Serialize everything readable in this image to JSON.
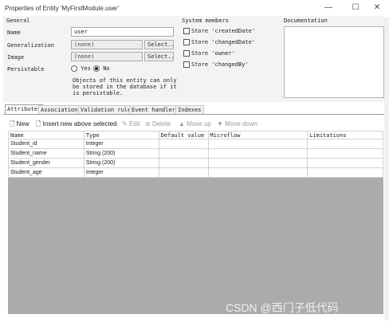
{
  "window": {
    "title": "Properties of Entity 'MyFirstModule.user'",
    "min": "—",
    "max": "☐",
    "close": "✕"
  },
  "general": {
    "group_label": "General",
    "name_label": "Name",
    "name_value": "user",
    "generalization_label": "Generalization",
    "generalization_value": "(none)",
    "generalization_select": "Select..",
    "image_label": "Image",
    "image_value": "(none)",
    "image_select": "Select..",
    "persistable_label": "Persistable",
    "yes_label": "Yes",
    "no_label": "No",
    "note": [
      "Objects of this entity can only",
      "be stored in the database if it",
      "is persistable."
    ]
  },
  "system_members": {
    "group_label": "System members",
    "items": [
      "Store 'createdDate'",
      "Store 'changedDate'",
      "Store 'owner'",
      "Store 'changedBy'"
    ]
  },
  "documentation": {
    "group_label": "Documentation"
  },
  "tabs": [
    "Attributes",
    "Associations",
    "Validation rules",
    "Event handlers",
    "Indexes"
  ],
  "toolbar": {
    "new": "New",
    "insert": "Insert new above selected",
    "edit": "Edit",
    "delete": "Delete",
    "move_up": "Move up",
    "move_down": "Move down"
  },
  "table": {
    "columns": [
      "Name",
      "Type",
      "Default value",
      "Microflow",
      "Limitations"
    ],
    "rows": [
      [
        "Student_id",
        "Integer",
        "",
        "",
        ""
      ],
      [
        "Student_name",
        "String (200)",
        "",
        "",
        ""
      ],
      [
        "Student_gender",
        "String (200)",
        "",
        "",
        ""
      ],
      [
        "Student_age",
        "Integer",
        "",
        "",
        ""
      ]
    ]
  },
  "watermark": "CSDN @西门子低代码",
  "colors": {
    "background": "#ffffff",
    "grid_empty": "#ababab",
    "panel": "#f3f3f3"
  }
}
